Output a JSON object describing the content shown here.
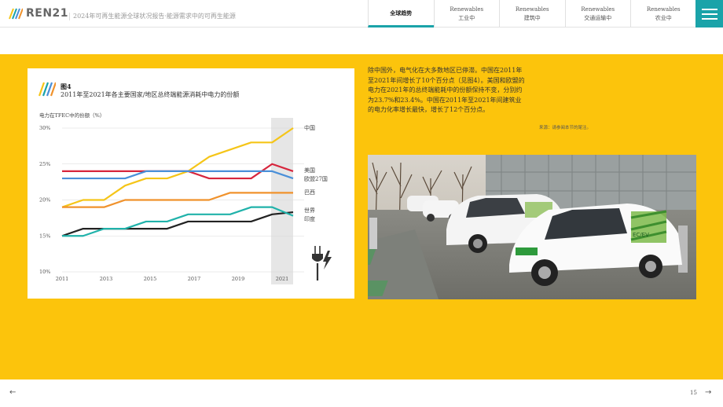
{
  "header": {
    "logo_text": "REN21",
    "subtitle": "2024年可再生能源全球状况报告·能源需求中的可再生能源",
    "tabs": [
      {
        "line1": "",
        "line2": "全球趋势",
        "active": true
      },
      {
        "line1": "Renewables",
        "line2": "工业中",
        "active": false
      },
      {
        "line1": "Renewables",
        "line2": "建筑中",
        "active": false
      },
      {
        "line1": "Renewables",
        "line2": "交通运输中",
        "active": false
      },
      {
        "line1": "Renewables",
        "line2": "农业中",
        "active": false
      }
    ],
    "menu_icon": "hamburger-menu-icon"
  },
  "colors": {
    "accent_teal": "#1aa3a9",
    "band_yellow": "#fcc40c"
  },
  "figure": {
    "number": "图4",
    "title": "2011年至2021年各主要国家/地区总终端能源消耗中电力的份额"
  },
  "chart_data": {
    "type": "line",
    "ylabel": "电力在TFEC中的份额（%）",
    "ylim": [
      10,
      30
    ],
    "yticks": [
      "10%",
      "15%",
      "20%",
      "25%",
      "30%"
    ],
    "ytick_values": [
      10,
      15,
      20,
      25,
      30
    ],
    "x": [
      2011,
      2012,
      2013,
      2014,
      2015,
      2016,
      2017,
      2018,
      2019,
      2020,
      2021
    ],
    "xticks": [
      "2011",
      "2013",
      "2015",
      "2017",
      "2019",
      "2021"
    ],
    "xtick_values": [
      2011,
      2013,
      2015,
      2017,
      2019,
      2021
    ],
    "highlight_year": 2021,
    "icon": "plug-lightning-icon",
    "series": [
      {
        "name": "中国",
        "color": "#f5c518",
        "values": [
          19,
          20,
          20,
          22,
          23,
          23,
          24,
          26,
          27,
          28,
          28,
          30
        ]
      },
      {
        "name": "美国",
        "color": "#d7263d",
        "values": [
          24,
          24,
          24,
          24,
          24,
          24,
          24,
          23,
          23,
          23,
          25,
          24
        ]
      },
      {
        "name": "欧盟27国",
        "color": "#4a90d9",
        "values": [
          23,
          23,
          23,
          23,
          24,
          24,
          24,
          24,
          24,
          24,
          24,
          23
        ]
      },
      {
        "name": "巴西",
        "color": "#f0922c",
        "values": [
          19,
          19,
          19,
          20,
          20,
          20,
          20,
          20,
          21,
          21,
          21,
          21
        ]
      },
      {
        "name": "世界",
        "color": "#222222",
        "values": [
          15,
          16,
          16,
          16,
          16,
          16,
          17,
          17,
          17,
          17,
          18,
          18.3
        ]
      },
      {
        "name": "印度",
        "color": "#20b2aa",
        "values": [
          15,
          15,
          16,
          16,
          17,
          17,
          18,
          18,
          18,
          19,
          19,
          17.8
        ]
      }
    ]
  },
  "text": {
    "paragraph": "除中国外，电气化在大多数地区已停滞。中国在2011年至2021年间增长了10个百分点（见图4）。美国和欧盟的电力在2021年的总终端能耗中的份额保持不变，分别约为23.7%和23.4%。中国在2011年至2021年间建筑业的电力化率增长最快，增长了12个百分点。",
    "source": "来源：请参阅本节的尾注。"
  },
  "photo": {
    "car_brand": "EC/EV"
  },
  "footer": {
    "prev_arrow": "←",
    "page_number": "15",
    "next_arrow": "→"
  }
}
